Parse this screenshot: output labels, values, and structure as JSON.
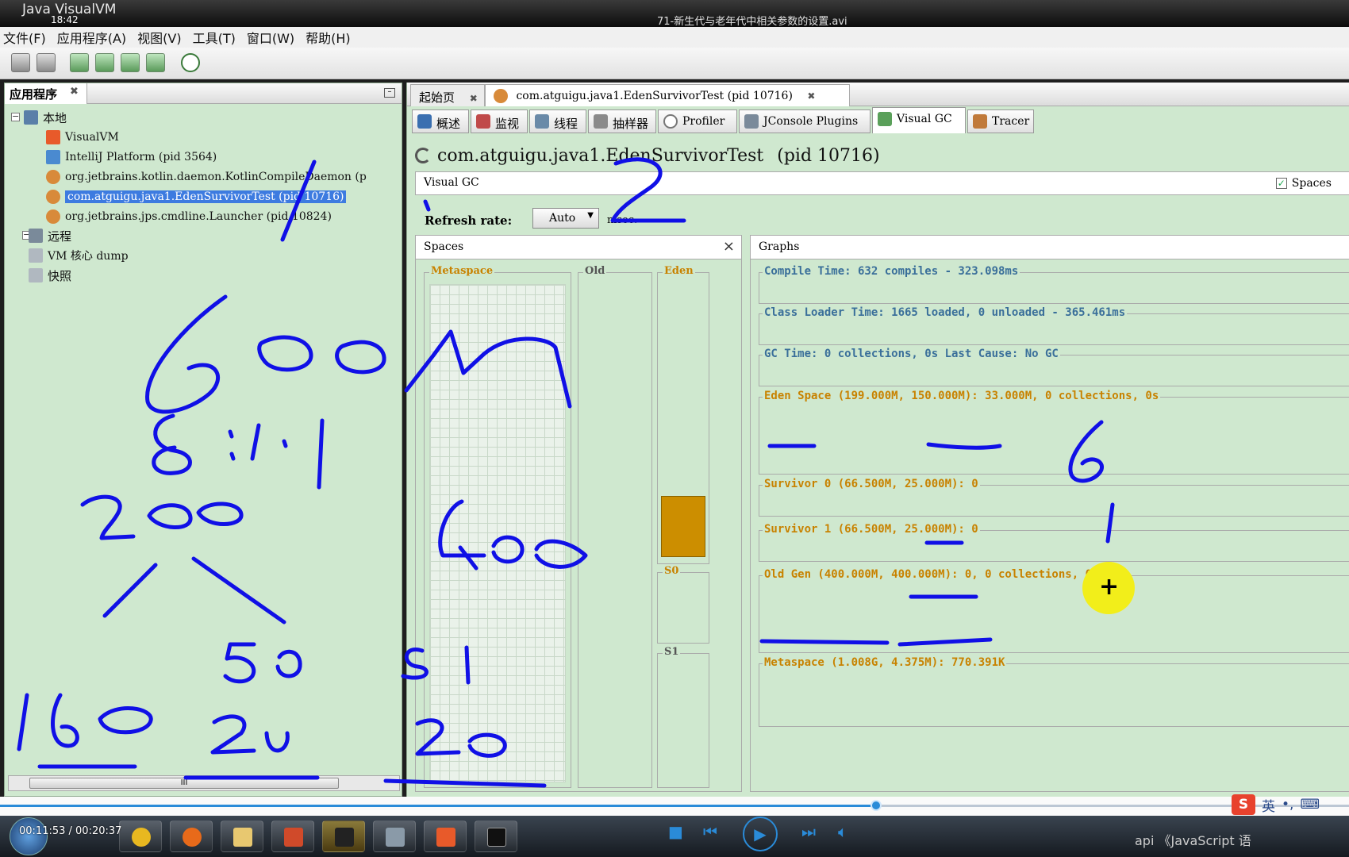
{
  "window": {
    "app_title": "Java VisualVM",
    "clock": "18:42",
    "video_title": "71-新生代与老年代中相关参数的设置.avi"
  },
  "menu": [
    "文件(F)",
    "应用程序(A)",
    "视图(V)",
    "工具(T)",
    "窗口(W)",
    "帮助(H)"
  ],
  "left_panel": {
    "tab_label": "应用程序",
    "tree": {
      "local": "本地",
      "visualvm": "VisualVM",
      "intellij": "IntelliJ Platform (pid 3564)",
      "kotlin": "org.jetbrains.kotlin.daemon.KotlinCompileDaemon (p",
      "eden_test": "com.atguigu.java1.EdenSurvivorTest (pid 10716)",
      "launcher": "org.jetbrains.jps.cmdline.Launcher (pid 10824)",
      "remote": "远程",
      "core_dump": "VM 核心 dump",
      "snapshot": "快照"
    },
    "scroll_thumb": "III"
  },
  "doc_tabs": {
    "start": "起始页",
    "process": "com.atguigu.java1.EdenSurvivorTest (pid 10716)"
  },
  "view_tabs": [
    "概述",
    "监视",
    "线程",
    "抽样器",
    "Profiler",
    "JConsole Plugins",
    "Visual GC",
    "Tracer"
  ],
  "main": {
    "process_title": "com.atguigu.java1.EdenSurvivorTest",
    "process_pid": "(pid 10716)",
    "visual_gc_label": "Visual GC",
    "spaces_checkbox": "Spaces",
    "refresh_label": "Refresh rate:",
    "refresh_value": "Auto",
    "refresh_unit": "msec."
  },
  "spaces_panel": {
    "title": "Spaces",
    "labels": {
      "metaspace": "Metaspace",
      "old": "Old",
      "eden": "Eden",
      "s0": "S0",
      "s1": "S1"
    },
    "eden_used_fraction": 0.22
  },
  "graphs_panel": {
    "title": "Graphs",
    "compile_time": "Compile Time: 632 compiles - 323.098ms",
    "class_loader": "Class Loader Time: 1665 loaded, 0 unloaded - 365.461ms",
    "gc_time": "GC Time: 0 collections, 0s Last Cause: No GC",
    "eden": "Eden Space (199.000M, 150.000M): 33.000M, 0 collections, 0s",
    "survivor0": "Survivor 0 (66.500M, 25.000M): 0",
    "survivor1": "Survivor 1 (66.500M, 25.000M): 0",
    "old_gen": "Old Gen (400.000M, 400.000M): 0, 0 collections, 0s",
    "metaspace": "Metaspace (1.008G, 4.375M): 770.391K"
  },
  "player": {
    "time": "00:11:53 / 00:20:37",
    "progress": 0.65
  },
  "ime": {
    "mode": "英"
  },
  "tray": {
    "text": "api  《JavaScript 语"
  },
  "colors": {
    "panel_bg": "#cfe8cf",
    "ink": "#1010e6",
    "eden_fill": "#cc8e00",
    "selection": "#3d7be0"
  }
}
